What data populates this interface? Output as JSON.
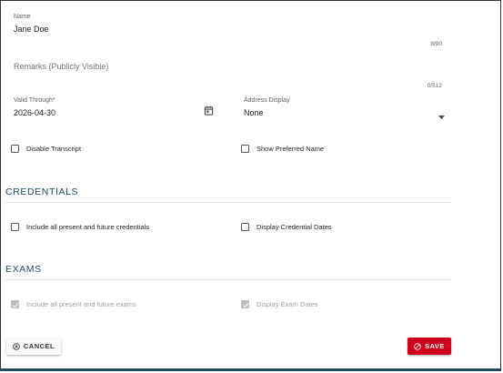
{
  "form": {
    "name": {
      "label": "Name",
      "value": "Jane Doe",
      "counter": "8/90"
    },
    "remarks": {
      "placeholder": "Remarks (Publicly Visible)",
      "counter": "0/512"
    },
    "valid_through": {
      "label": "Valid Through*",
      "value": "2026-04-30",
      "icon": "calendar-icon"
    },
    "address_display": {
      "label": "Address Display",
      "value": "None",
      "icon": "dropdown-arrow-icon"
    },
    "disable_transcript": {
      "label": "Disable Transcript",
      "checked": false
    },
    "show_preferred_name": {
      "label": "Show Preferred Name",
      "checked": false
    }
  },
  "credentials": {
    "title": "CREDENTIALS",
    "include_all": {
      "label": "Include all present and future credentials",
      "checked": false
    },
    "display_dates": {
      "label": "Display Credential Dates",
      "checked": false
    }
  },
  "exams": {
    "title": "EXAMS",
    "include_all": {
      "label": "Include all present and future exams",
      "checked": true,
      "disabled": true
    },
    "display_dates": {
      "label": "Display Exam Dates",
      "checked": true,
      "disabled": true
    }
  },
  "actions": {
    "cancel_label": "CANCEL",
    "cancel_icon": "cancel-circle-icon",
    "save_label": "SAVE",
    "save_icon": "save-circle-icon",
    "save_color": "#d0021b"
  },
  "colors": {
    "accent": "#1f4a5c"
  }
}
